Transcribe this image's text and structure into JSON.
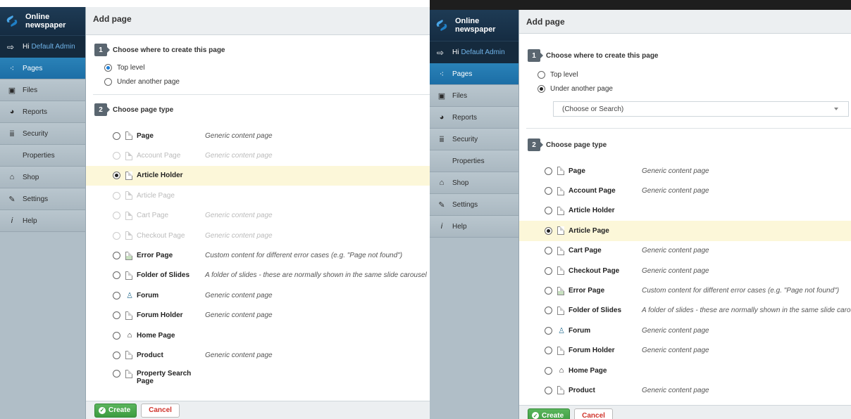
{
  "brand": {
    "name": "Online newspaper"
  },
  "user": {
    "greeting": "Hi",
    "name": "Default Admin"
  },
  "nav": [
    {
      "label": "Pages",
      "icon": "sitemap-icon"
    },
    {
      "label": "Files",
      "icon": "image-icon"
    },
    {
      "label": "Reports",
      "icon": "pie-chart-icon"
    },
    {
      "label": "Security",
      "icon": "users-icon"
    },
    {
      "label": "Properties",
      "icon": ""
    },
    {
      "label": "Shop",
      "icon": "bank-icon"
    },
    {
      "label": "Settings",
      "icon": "wrench-icon"
    },
    {
      "label": "Help",
      "icon": "info-icon"
    }
  ],
  "header": {
    "title": "Add page"
  },
  "step1": {
    "num": "1",
    "title": "Choose where to create this page",
    "top_level": "Top level",
    "under_another": "Under another page"
  },
  "step2": {
    "num": "2",
    "title": "Choose page type"
  },
  "dropdown": {
    "placeholder": "(Choose or Search)"
  },
  "page_types": [
    {
      "title": "Page",
      "desc": "Generic content page"
    },
    {
      "title": "Account Page",
      "desc": "Generic content page"
    },
    {
      "title": "Article Holder",
      "desc": ""
    },
    {
      "title": "Article Page",
      "desc": ""
    },
    {
      "title": "Cart Page",
      "desc": "Generic content page"
    },
    {
      "title": "Checkout Page",
      "desc": "Generic content page"
    },
    {
      "title": "Error Page",
      "desc": "Custom content for different error cases (e.g. \"Page not found\")"
    },
    {
      "title": "Folder of Slides",
      "desc": "A folder of slides - these are normally shown in the same slide carousel"
    },
    {
      "title": "Forum",
      "desc": "Generic content page"
    },
    {
      "title": "Forum Holder",
      "desc": "Generic content page"
    },
    {
      "title": "Home Page",
      "desc": ""
    },
    {
      "title": "Product",
      "desc": "Generic content page"
    },
    {
      "title": "Property Search Page",
      "desc": ""
    }
  ],
  "left": {
    "selected_location": "Top level",
    "selected_type": "Article Holder"
  },
  "right": {
    "selected_location": "Under another page",
    "selected_type": "Article Page"
  },
  "footer": {
    "create": "Create",
    "cancel": "Cancel"
  },
  "colors": {
    "active_nav": "#2280b8",
    "sidebar": "#b0bec7",
    "highlight": "#fcf7d9",
    "create_green": "#4aa64d",
    "cancel_red": "#d0342c"
  }
}
